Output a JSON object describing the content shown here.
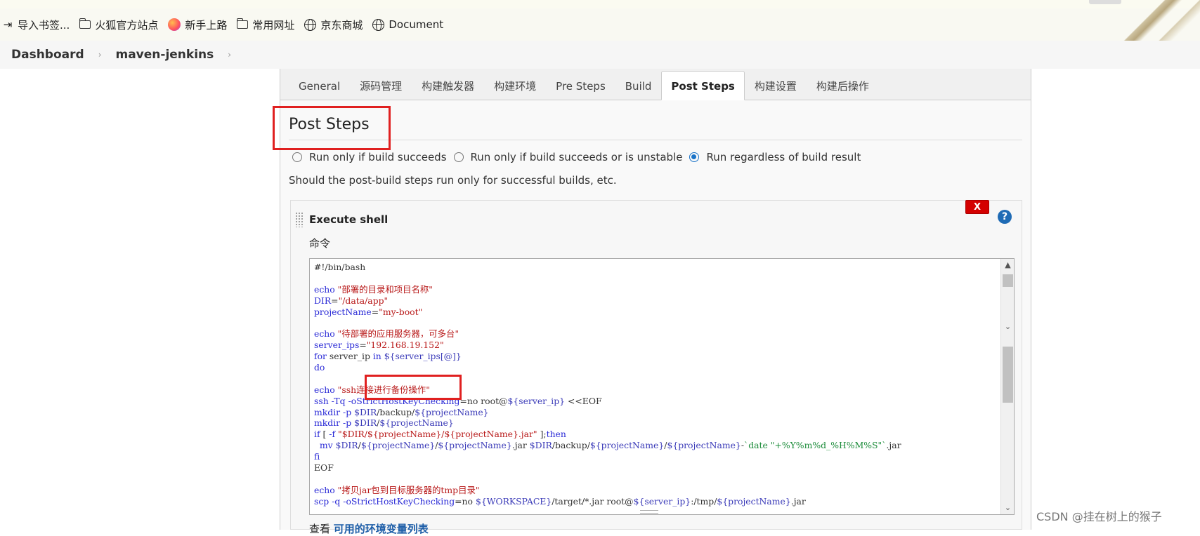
{
  "browser": {
    "bookmarks": [
      {
        "label": "导入书签...",
        "icon": "import-icon"
      },
      {
        "label": "火狐官方站点",
        "icon": "folder-icon"
      },
      {
        "label": "新手上路",
        "icon": "firefox-icon"
      },
      {
        "label": "常用网址",
        "icon": "folder-icon"
      },
      {
        "label": "京东商城",
        "icon": "globe-icon"
      },
      {
        "label": "Document",
        "icon": "globe-icon"
      }
    ]
  },
  "breadcrumb": {
    "items": [
      "Dashboard",
      "maven-jenkins"
    ],
    "separator": "›"
  },
  "tabs": [
    {
      "label": "General"
    },
    {
      "label": "源码管理"
    },
    {
      "label": "构建触发器"
    },
    {
      "label": "构建环境"
    },
    {
      "label": "Pre Steps"
    },
    {
      "label": "Build"
    },
    {
      "label": "Post Steps",
      "active": true
    },
    {
      "label": "构建设置"
    },
    {
      "label": "构建后操作"
    }
  ],
  "post_steps": {
    "title": "Post Steps",
    "options": [
      {
        "label": "Run only if build succeeds",
        "selected": false
      },
      {
        "label": "Run only if build succeeds or is unstable",
        "selected": false
      },
      {
        "label": "Run regardless of build result",
        "selected": true
      }
    ],
    "help": "Should the post-build steps run only for successful builds, etc.",
    "builder": {
      "title": "Execute shell",
      "delete_label": "X",
      "help_label": "?",
      "command_label": "命令",
      "script": [
        "#!/bin/bash",
        "",
        "echo \"部署的目录和项目名称\"",
        "DIR=\"/data/app\"",
        "projectName=\"my-boot\"",
        "",
        "echo \"待部署的应用服务器，可多台\"",
        "server_ips=\"192.168.19.152\"",
        "for server_ip in ${server_ips[@]}",
        "do",
        "",
        "echo \"ssh连接进行备份操作\"",
        "ssh -Tq -oStrictHostKeyChecking=no root@${server_ip} <<EOF",
        "mkdir -p $DIR/backup/${projectName}",
        "mkdir -p $DIR/${projectName}",
        "if [ -f \"$DIR/${projectName}/${projectName}.jar\" ];then",
        "  mv $DIR/${projectName}/${projectName}.jar $DIR/backup/${projectName}/${projectName}-`date \"+%Y%m%d_%H%M%S\"`.jar",
        "fi",
        "EOF",
        "",
        "echo \"拷贝jar包到目标服务器的tmp目录\"",
        "scp -q -oStrictHostKeyChecking=no ${WORKSPACE}/target/*.jar root@${server_ip}:/tmp/${projectName}.jar"
      ]
    },
    "env_prefix": "查看",
    "env_link": "可用的环境变量列表"
  },
  "colors": {
    "highlight_box": "#e02020",
    "link": "#1e5ea8",
    "delete": "#d40000"
  },
  "watermark": "CSDN @挂在树上的猴子"
}
